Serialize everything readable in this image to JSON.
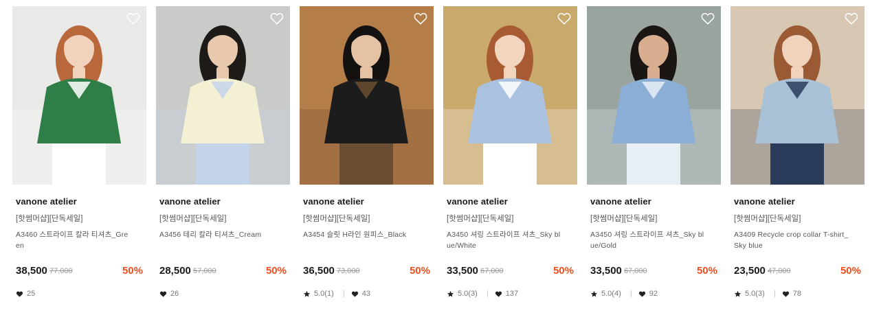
{
  "products": [
    {
      "brand": "vanone atelier",
      "tag": "[핫썸머샵][단독세일]",
      "name_line1": "A3460 스트라이프 칼라 티셔츠_Gre",
      "name_line2": "en",
      "price": "38,500",
      "original_price": "77,000",
      "discount": "50%",
      "rating": "",
      "likes": "25",
      "image": {
        "background": "#e9e9e7",
        "garment": "#2f7d47",
        "accent": "#ffffff",
        "hair": "#b9683b",
        "skin": "#f1d3bd"
      },
      "wishlist_icon": "heart-outline-icon"
    },
    {
      "brand": "vanone atelier",
      "tag": "[핫썸머샵][단독세일]",
      "name_line1": "A3456 테리 칼라 티셔츠_Cream",
      "name_line2": "",
      "price": "28,500",
      "original_price": "57,000",
      "discount": "50%",
      "rating": "",
      "likes": "26",
      "image": {
        "background": "#c8cbc8",
        "garment": "#f3f0d4",
        "accent": "#c3d4ea",
        "hair": "#1e1a18",
        "skin": "#e9c9ad"
      },
      "wishlist_icon": "heart-outline-icon"
    },
    {
      "brand": "vanone atelier",
      "tag": "[핫썸머샵][단독세일]",
      "name_line1": "A3454 슬릿 H라인 원피스_Black",
      "name_line2": "",
      "price": "36,500",
      "original_price": "73,000",
      "discount": "50%",
      "rating": "5.0(1)",
      "likes": "43",
      "image": {
        "background": "#b57d47",
        "garment": "#1c1c1c",
        "accent": "#6b4d33",
        "hair": "#141111",
        "skin": "#e5c2a4"
      },
      "wishlist_icon": "heart-outline-icon"
    },
    {
      "brand": "vanone atelier",
      "tag": "[핫썸머샵][단독세일]",
      "name_line1": "A3450 셔링 스트라이프 셔츠_Sky bl",
      "name_line2": "ue/White",
      "price": "33,500",
      "original_price": "67,000",
      "discount": "50%",
      "rating": "5.0(3)",
      "likes": "137",
      "image": {
        "background": "#c9a96c",
        "garment": "#aac2df",
        "accent": "#ffffff",
        "hair": "#a85b32",
        "skin": "#f3d4bf"
      },
      "wishlist_icon": "heart-outline-icon"
    },
    {
      "brand": "vanone atelier",
      "tag": "[핫썸머샵][단독세일]",
      "name_line1": "A3450 셔링 스트라이프 셔츠_Sky bl",
      "name_line2": "ue/Gold",
      "price": "33,500",
      "original_price": "67,000",
      "discount": "50%",
      "rating": "5.0(4)",
      "likes": "92",
      "image": {
        "background": "#9aa49f",
        "garment": "#8aaed6",
        "accent": "#e8eef6",
        "hair": "#1b1614",
        "skin": "#d9ad90"
      },
      "wishlist_icon": "heart-outline-icon"
    },
    {
      "brand": "vanone atelier",
      "tag": "[핫썸머샵][단독세일]",
      "name_line1": "A3409 Recycle crop collar T-shirt_",
      "name_line2": "Sky blue",
      "price": "23,500",
      "original_price": "47,000",
      "discount": "50%",
      "rating": "5.0(3)",
      "likes": "78",
      "image": {
        "background": "#d8c7b2",
        "garment": "#a9c1d6",
        "accent": "#2b3c5b",
        "hair": "#9a5a33",
        "skin": "#f0d2bd"
      },
      "wishlist_icon": "heart-outline-icon"
    }
  ],
  "colors": {
    "discount": "#f04e1f",
    "muted": "#777777",
    "strike": "#999999"
  },
  "icons": {
    "rating": "star-icon",
    "likes": "heart-filled-icon"
  }
}
